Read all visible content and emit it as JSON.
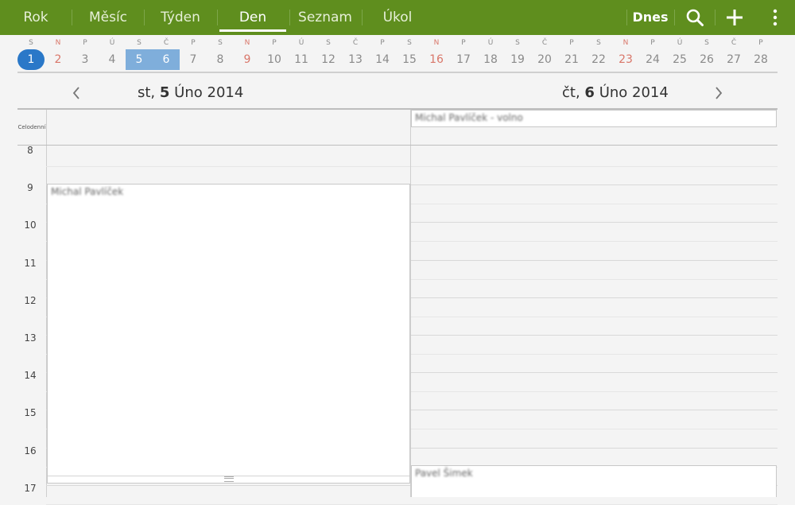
{
  "topbar": {
    "tabs": [
      {
        "label": "Rok"
      },
      {
        "label": "Měsíc"
      },
      {
        "label": "Týden"
      },
      {
        "label": "Den",
        "active": true
      },
      {
        "label": "Seznam"
      },
      {
        "label": "Úkol"
      }
    ],
    "today_label": "Dnes",
    "search_icon": "search-icon",
    "add_icon": "plus-icon",
    "menu_icon": "overflow-menu-icon",
    "color": "#5f8e1e"
  },
  "strip": {
    "days": [
      {
        "l": "S",
        "n": "1",
        "today": true
      },
      {
        "l": "N",
        "n": "2",
        "sunday": true
      },
      {
        "l": "P",
        "n": "3"
      },
      {
        "l": "Ú",
        "n": "4"
      },
      {
        "l": "S",
        "n": "5",
        "sel": true
      },
      {
        "l": "Č",
        "n": "6",
        "sel": true
      },
      {
        "l": "P",
        "n": "7"
      },
      {
        "l": "S",
        "n": "8"
      },
      {
        "l": "N",
        "n": "9",
        "sunday": true
      },
      {
        "l": "P",
        "n": "10"
      },
      {
        "l": "Ú",
        "n": "11"
      },
      {
        "l": "S",
        "n": "12"
      },
      {
        "l": "Č",
        "n": "13"
      },
      {
        "l": "P",
        "n": "14"
      },
      {
        "l": "S",
        "n": "15"
      },
      {
        "l": "N",
        "n": "16",
        "sunday": true
      },
      {
        "l": "P",
        "n": "17"
      },
      {
        "l": "Ú",
        "n": "18"
      },
      {
        "l": "S",
        "n": "19"
      },
      {
        "l": "Č",
        "n": "20"
      },
      {
        "l": "P",
        "n": "21"
      },
      {
        "l": "S",
        "n": "22"
      },
      {
        "l": "N",
        "n": "23",
        "sunday": true
      },
      {
        "l": "P",
        "n": "24"
      },
      {
        "l": "Ú",
        "n": "25"
      },
      {
        "l": "S",
        "n": "26"
      },
      {
        "l": "Č",
        "n": "27"
      },
      {
        "l": "P",
        "n": "28"
      }
    ]
  },
  "days": {
    "left": {
      "weekday": "st,",
      "day": "5",
      "month_year": "Úno 2014"
    },
    "right": {
      "weekday": "čt,",
      "day": "6",
      "month_year": "Úno 2014"
    }
  },
  "grid": {
    "allday_label": "Celodenní",
    "hours": [
      "8",
      "9",
      "10",
      "11",
      "12",
      "13",
      "14",
      "15",
      "16",
      "17"
    ]
  },
  "events": {
    "allday_right": "Michal Pavlíček - volno",
    "left_main": "Michal Pavlíček",
    "right_bottom": "Pavel Šimek"
  }
}
